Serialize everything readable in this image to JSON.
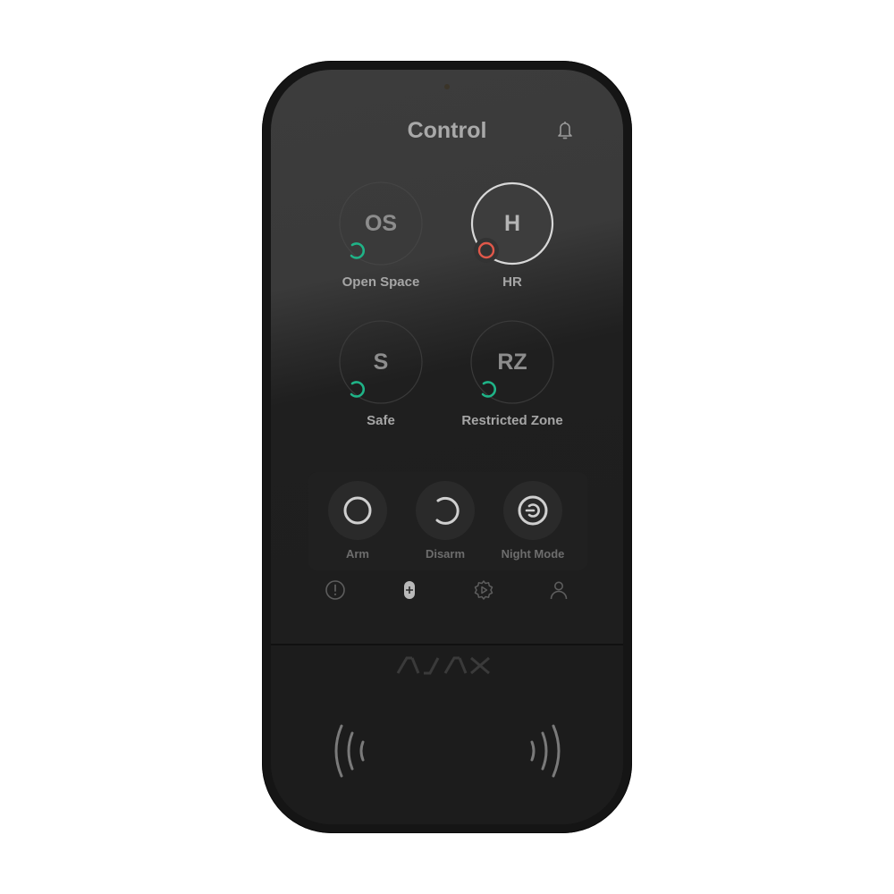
{
  "device": {
    "brand_logo": "AJAX",
    "screen": {
      "title": "Control",
      "notification_icon": "bell-icon",
      "groups": [
        {
          "abbr": "OS",
          "name": "Open Space",
          "status": "disarmed",
          "status_color": "#1fb387",
          "selected": false
        },
        {
          "abbr": "H",
          "name": "HR",
          "status": "armed",
          "status_color": "#e0584a",
          "selected": true
        },
        {
          "abbr": "S",
          "name": "Safe",
          "status": "disarmed",
          "status_color": "#1fb387",
          "selected": false
        },
        {
          "abbr": "RZ",
          "name": "Restricted Zone",
          "status": "disarmed",
          "status_color": "#1fb387",
          "selected": false
        }
      ],
      "modes": [
        {
          "label": "Arm",
          "icon": "arm-icon"
        },
        {
          "label": "Disarm",
          "icon": "disarm-icon"
        },
        {
          "label": "Night Mode",
          "icon": "night-mode-icon"
        }
      ],
      "nav": [
        {
          "name": "alarm",
          "icon": "alert-circle-icon",
          "active": false
        },
        {
          "name": "control",
          "icon": "control-plus-icon",
          "active": true
        },
        {
          "name": "scenarios",
          "icon": "gear-play-icon",
          "active": false
        },
        {
          "name": "user",
          "icon": "user-icon",
          "active": false
        }
      ]
    },
    "card_reader_icon": "nfc-waves-icon"
  }
}
